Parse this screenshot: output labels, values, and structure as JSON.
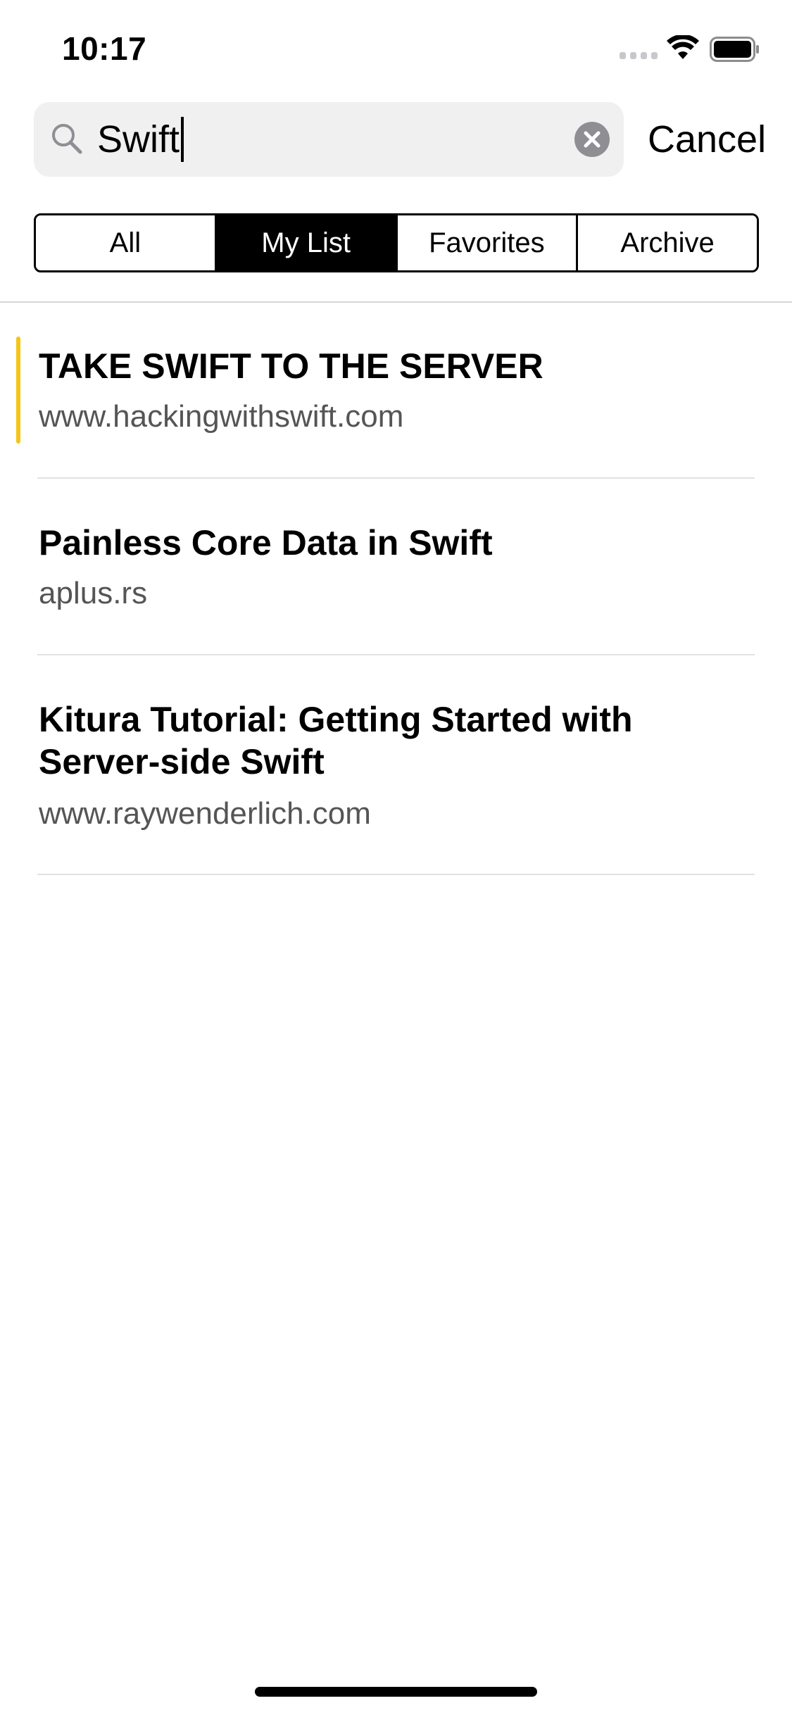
{
  "status_bar": {
    "time": "10:17"
  },
  "search": {
    "value": "Swift",
    "cancel_label": "Cancel"
  },
  "tabs": [
    {
      "label": "All",
      "selected": false
    },
    {
      "label": "My List",
      "selected": true
    },
    {
      "label": "Favorites",
      "selected": false
    },
    {
      "label": "Archive",
      "selected": false
    }
  ],
  "results": [
    {
      "title": "TAKE SWIFT TO THE SERVER",
      "domain": "www.hackingwithswift.com",
      "highlighted": true
    },
    {
      "title": "Painless Core Data in Swift",
      "domain": "aplus.rs",
      "highlighted": false
    },
    {
      "title": "Kitura Tutorial: Getting Started with Server-side Swift",
      "domain": "www.raywenderlich.com",
      "highlighted": false
    }
  ],
  "colors": {
    "highlight_accent": "#f5c518",
    "selected_tab_bg": "#000000",
    "search_bg": "#f0f0f0"
  },
  "icons": {
    "search": "magnifying-glass",
    "clear": "x-circle",
    "signal": "cellular-signal",
    "wifi": "wifi",
    "battery": "battery-full"
  }
}
